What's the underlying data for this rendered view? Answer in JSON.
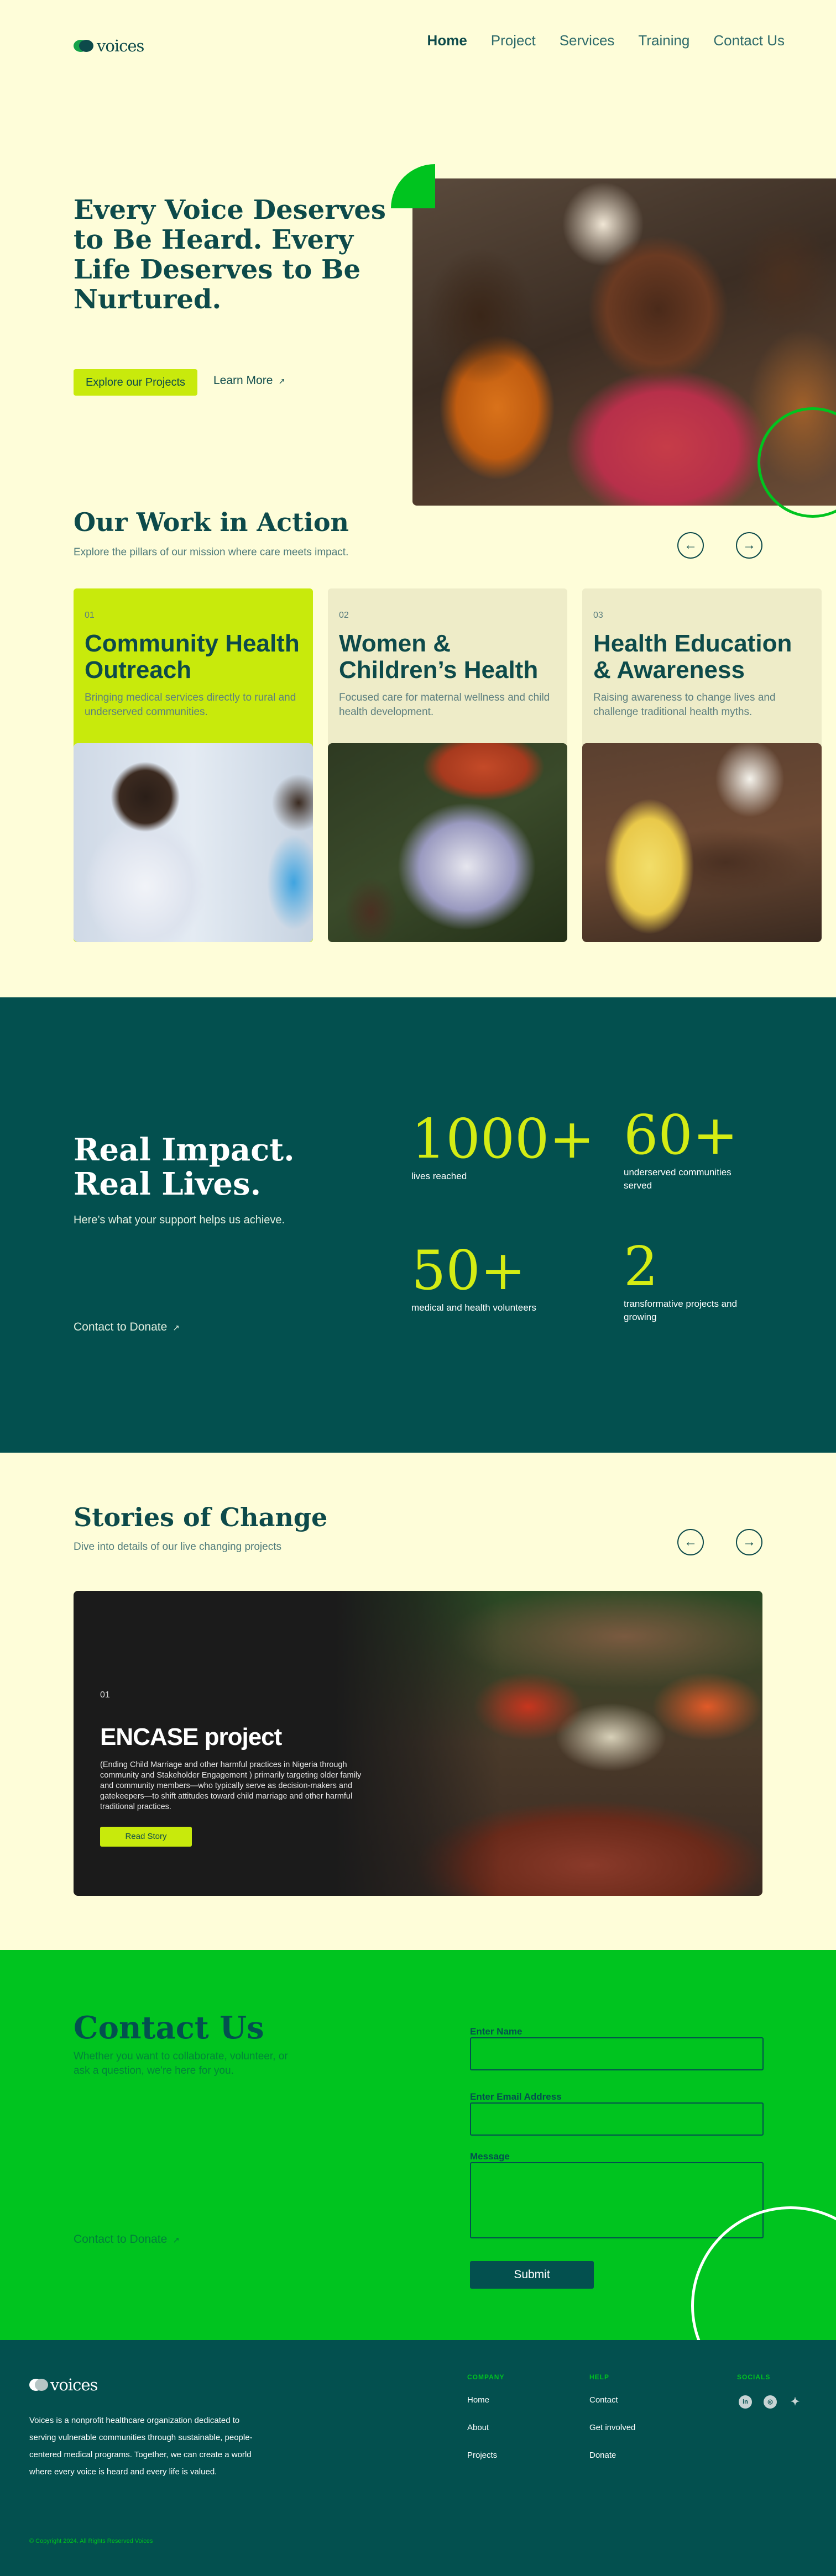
{
  "header": {
    "logo_text": "voices",
    "nav": [
      "Home",
      "Project",
      "Services",
      "Training",
      "Contact Us"
    ]
  },
  "hero": {
    "title": "Every Voice Deserves to Be Heard. Every Life Deserves to Be Nurtured.",
    "primary_button": "Explore our Projects",
    "secondary_link": "Learn More",
    "arrow": "↗"
  },
  "work": {
    "title": "Our Work in Action",
    "subtitle": "Explore the pillars of our mission where care meets impact.",
    "prev": "←",
    "next": "→",
    "cards": [
      {
        "num": "01",
        "title": "Community Health Outreach",
        "desc": "Bringing medical services directly to rural and underserved communities."
      },
      {
        "num": "02",
        "title": "Women & Children’s Health",
        "desc": "Focused care for maternal wellness and child health development."
      },
      {
        "num": "03",
        "title": "Health Education & Awareness",
        "desc": "Raising awareness to change lives and challenge traditional health myths."
      }
    ]
  },
  "impact": {
    "title": "Real Impact. Real Lives.",
    "subtitle": "Here’s what your support helps us achieve.",
    "link": "Contact to Donate",
    "arrow": "↗",
    "stats": [
      {
        "value": "1000+",
        "label": "lives reached"
      },
      {
        "value": "60+",
        "label": "underserved communities served"
      },
      {
        "value": "50+",
        "label": "medical and health volunteers"
      },
      {
        "value": "2",
        "label": "transformative projects and growing"
      }
    ]
  },
  "stories": {
    "title": "Stories of Change",
    "subtitle": "Dive into details of our live changing projects",
    "prev": "←",
    "next": "→",
    "card": {
      "num": "01",
      "title": "ENCASE project",
      "desc": "(Ending Child Marriage  and other harmful practices in Nigeria through community and Stakeholder Engagement ) primarily targeting   older family and  community members—who typically serve as decision-makers and gatekeepers—to shift attitudes toward child marriage and other harmful traditional practices.",
      "button": "Read Story"
    }
  },
  "contact": {
    "title": "Contact Us",
    "subtitle": "Whether you want to collaborate, volunteer, or ask a question, we're here for you.",
    "link": "Contact to Donate",
    "arrow": "↗",
    "name_label": "Enter Name",
    "email_label": "Enter Email Address",
    "message_label": "Message",
    "submit": "Submit"
  },
  "footer": {
    "logo_text": "voices",
    "description": "Voices is a nonprofit healthcare organization dedicated to serving vulnerable communities through sustainable, people-centered medical programs. Together, we can create a world where every voice is heard and every life is valued.",
    "company_title": "COMPANY",
    "company_links": [
      "Home",
      "About",
      "Projects"
    ],
    "help_title": "HELP",
    "help_links": [
      "Contact",
      "Get involved",
      "Donate"
    ],
    "socials_title": "SOCIALS",
    "socials": [
      "in",
      "◎",
      "✦"
    ],
    "copyright": "© Copyright 2024. All Rights Reserved Voices"
  },
  "colors": {
    "background": "#fefdd9",
    "dark_teal": "#03504f",
    "green": "#00c41f",
    "lime": "#c8ea0c"
  }
}
